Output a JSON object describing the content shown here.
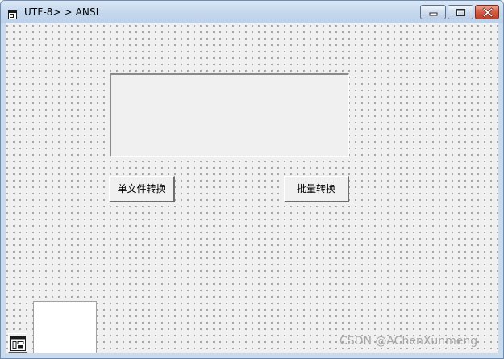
{
  "window": {
    "title": "UTF-8> > ANSI",
    "icon": "form-icon",
    "controls": {
      "minimize_icon": "minimize-icon",
      "maximize_icon": "maximize-icon",
      "close_icon": "close-icon"
    }
  },
  "form": {
    "textbox_value": "",
    "single_convert_label": "单文件转换",
    "batch_convert_label": "批量转换"
  },
  "toolbox": {
    "icon": "form-designer-icon"
  },
  "watermark": {
    "text": "CSDN @AChenXunmeng"
  },
  "colors": {
    "titlebar": "#c3d6ec",
    "client_background": "#f0f0f0",
    "close_button": "#d45d45",
    "grid_dots": "#1a1a1a"
  }
}
